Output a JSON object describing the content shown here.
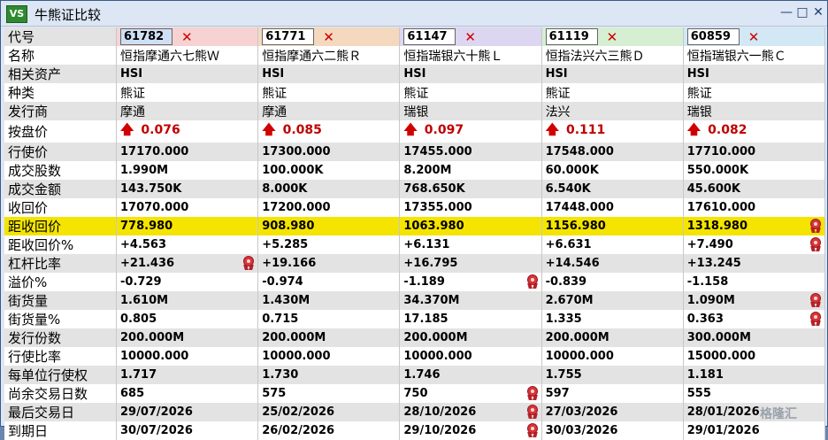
{
  "window": {
    "icon_text": "VS",
    "title": "牛熊证比较",
    "minimize": "—",
    "maximize": "□",
    "close": "✕"
  },
  "columns": [
    {
      "code": "61782",
      "color": "#f6d2d2",
      "name": "恒指摩通六七熊Ｗ",
      "underlying": "HSI",
      "type": "熊证",
      "issuer": "摩通",
      "price": "0.076",
      "strike": "17170.000",
      "volume": "1.990M",
      "turnover": "143.750K",
      "call_price": "17070.000",
      "dist_call": "778.980",
      "dist_call_pct": "+4.563",
      "leverage": "+21.436",
      "premium": "-0.729",
      "outstanding": "1.610M",
      "outstanding_pct": "0.805",
      "issue_size": "200.000M",
      "conv_ratio": "10000.000",
      "eff_gearing": "1.717",
      "days_left": "685",
      "last_trade": "29/07/2026",
      "expiry": "30/07/2026"
    },
    {
      "code": "61771",
      "color": "#f5d9bf",
      "name": "恒指摩通六二熊Ｒ",
      "underlying": "HSI",
      "type": "熊证",
      "issuer": "摩通",
      "price": "0.085",
      "strike": "17300.000",
      "volume": "100.000K",
      "turnover": "8.000K",
      "call_price": "17200.000",
      "dist_call": "908.980",
      "dist_call_pct": "+5.285",
      "leverage": "+19.166",
      "premium": "-0.974",
      "outstanding": "1.430M",
      "outstanding_pct": "0.715",
      "issue_size": "200.000M",
      "conv_ratio": "10000.000",
      "eff_gearing": "1.730",
      "days_left": "575",
      "last_trade": "25/02/2026",
      "expiry": "26/02/2026"
    },
    {
      "code": "61147",
      "color": "#dcd6f1",
      "name": "恒指瑞银六十熊Ｌ",
      "underlying": "HSI",
      "type": "熊证",
      "issuer": "瑞银",
      "price": "0.097",
      "strike": "17455.000",
      "volume": "8.200M",
      "turnover": "768.650K",
      "call_price": "17355.000",
      "dist_call": "1063.980",
      "dist_call_pct": "+6.131",
      "leverage": "+16.795",
      "premium": "-1.189",
      "outstanding": "34.370M",
      "outstanding_pct": "17.185",
      "issue_size": "200.000M",
      "conv_ratio": "10000.000",
      "eff_gearing": "1.746",
      "days_left": "750",
      "last_trade": "28/10/2026",
      "expiry": "29/10/2026"
    },
    {
      "code": "61119",
      "color": "#d6efd2",
      "name": "恒指法兴六三熊Ｄ",
      "underlying": "HSI",
      "type": "熊证",
      "issuer": "法兴",
      "price": "0.111",
      "strike": "17548.000",
      "volume": "60.000K",
      "turnover": "6.540K",
      "call_price": "17448.000",
      "dist_call": "1156.980",
      "dist_call_pct": "+6.631",
      "leverage": "+14.546",
      "premium": "-0.839",
      "outstanding": "2.670M",
      "outstanding_pct": "1.335",
      "issue_size": "200.000M",
      "conv_ratio": "10000.000",
      "eff_gearing": "1.755",
      "days_left": "597",
      "last_trade": "27/03/2026",
      "expiry": "30/03/2026"
    },
    {
      "code": "60859",
      "color": "#d2e8f4",
      "name": "恒指瑞银六一熊Ｃ",
      "underlying": "HSI",
      "type": "熊证",
      "issuer": "瑞银",
      "price": "0.082",
      "strike": "17710.000",
      "volume": "550.000K",
      "turnover": "45.600K",
      "call_price": "17610.000",
      "dist_call": "1318.980",
      "dist_call_pct": "+7.490",
      "leverage": "+13.245",
      "premium": "-1.158",
      "outstanding": "1.090M",
      "outstanding_pct": "0.363",
      "issue_size": "300.000M",
      "conv_ratio": "15000.000",
      "eff_gearing": "1.181",
      "days_left": "555",
      "last_trade": "28/01/2026",
      "expiry": "29/01/2026"
    }
  ],
  "rows": [
    {
      "label": "代号",
      "field": "code",
      "alt": true
    },
    {
      "label": "名称",
      "field": "name",
      "alt": false
    },
    {
      "label": "相关资产",
      "field": "underlying",
      "alt": true
    },
    {
      "label": "种类",
      "field": "type",
      "alt": false
    },
    {
      "label": "发行商",
      "field": "issuer",
      "alt": true
    },
    {
      "label": "按盘价",
      "field": "price",
      "alt": false
    },
    {
      "label": "行使价",
      "field": "strike",
      "alt": true
    },
    {
      "label": "成交股数",
      "field": "volume",
      "alt": false
    },
    {
      "label": "成交金额",
      "field": "turnover",
      "alt": true
    },
    {
      "label": "收回价",
      "field": "call_price",
      "alt": false
    },
    {
      "label": "距收回价",
      "field": "dist_call",
      "alt": false,
      "highlight": true
    },
    {
      "label": "距收回价%",
      "field": "dist_call_pct",
      "alt": false
    },
    {
      "label": "杠杆比率",
      "field": "leverage",
      "alt": true
    },
    {
      "label": "溢价%",
      "field": "premium",
      "alt": false
    },
    {
      "label": "街货量",
      "field": "outstanding",
      "alt": true
    },
    {
      "label": "街货量%",
      "field": "outstanding_pct",
      "alt": false
    },
    {
      "label": "发行份数",
      "field": "issue_size",
      "alt": true
    },
    {
      "label": "行使比率",
      "field": "conv_ratio",
      "alt": false
    },
    {
      "label": "每单位行使权",
      "field": "eff_gearing",
      "alt": true
    },
    {
      "label": "尚余交易日数",
      "field": "days_left",
      "alt": false
    },
    {
      "label": "最后交易日",
      "field": "last_trade",
      "alt": true
    },
    {
      "label": "到期日",
      "field": "expiry",
      "alt": false
    }
  ],
  "medals": [
    {
      "row": "dist_call",
      "col": 4
    },
    {
      "row": "dist_call_pct",
      "col": 4
    },
    {
      "row": "leverage",
      "col": 0
    },
    {
      "row": "premium",
      "col": 2
    },
    {
      "row": "outstanding",
      "col": 4
    },
    {
      "row": "outstanding_pct",
      "col": 4
    },
    {
      "row": "days_left",
      "col": 2
    },
    {
      "row": "last_trade",
      "col": 2
    },
    {
      "row": "expiry",
      "col": 2
    }
  ],
  "remove_symbol": "✕",
  "up_arrow_symbol": "🡅",
  "selected_code_index": 0,
  "watermark": "格隆汇",
  "colors": {
    "highlight_row": "#f4e400",
    "price_text": "#c00000",
    "remove_button": "#d00000"
  }
}
